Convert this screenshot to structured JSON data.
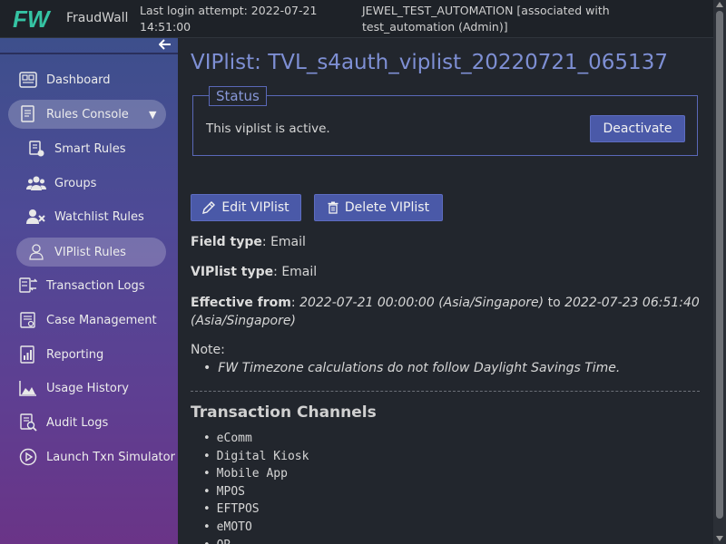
{
  "app": {
    "brand": "FraudWall",
    "logo_text": "FW",
    "login_text": "Last login attempt: 2022-07-21 14:51:00",
    "user_text": "JEWEL_TEST_AUTOMATION [associated with test_automation (Admin)]"
  },
  "sidebar": {
    "collapse_icon": "arrow-left-icon",
    "items": [
      {
        "label": "Dashboard",
        "icon": "dashboard-icon"
      },
      {
        "label": "Rules Console",
        "icon": "rules-console-icon",
        "expanded": true
      },
      {
        "label": "Smart Rules",
        "icon": "smart-rules-icon"
      },
      {
        "label": "Groups",
        "icon": "groups-icon"
      },
      {
        "label": "Watchlist Rules",
        "icon": "watchlist-icon"
      },
      {
        "label": "VIPlist Rules",
        "icon": "viplist-icon",
        "active": true
      },
      {
        "label": "Transaction Logs",
        "icon": "transaction-logs-icon"
      },
      {
        "label": "Case Management",
        "icon": "case-management-icon"
      },
      {
        "label": "Reporting",
        "icon": "reporting-icon"
      },
      {
        "label": "Usage History",
        "icon": "usage-history-icon"
      },
      {
        "label": "Audit Logs",
        "icon": "audit-logs-icon"
      },
      {
        "label": "Launch Txn Simulator",
        "icon": "play-icon"
      }
    ]
  },
  "main": {
    "title": "VIPlist: TVL_s4auth_viplist_20220721_065137",
    "status": {
      "legend": "Status",
      "text": "This viplist is active.",
      "button": "Deactivate"
    },
    "actions": {
      "edit": "Edit VIPlist",
      "delete": "Delete VIPlist"
    },
    "field_type": {
      "label": "Field type",
      "value": "Email"
    },
    "viplist_type": {
      "label": "VIPlist type",
      "value": "Email"
    },
    "effective": {
      "label": "Effective from",
      "from": "2022-07-21 00:00:00 (Asia/Singapore)",
      "to_word": "to",
      "to": "2022-07-23 06:51:40 (Asia/Singapore)"
    },
    "note": {
      "label": "Note:",
      "items": [
        "FW Timezone calculations do not follow Daylight Savings Time."
      ]
    },
    "channels": {
      "title": "Transaction Channels",
      "items": [
        "eComm",
        "Digital Kiosk",
        "Mobile App",
        "MPOS",
        "EFTPOS",
        "eMOTO",
        "QR"
      ]
    }
  },
  "colors": {
    "accent": "#4a59a8",
    "title": "#7e8fd4",
    "background": "#22262d",
    "logo": "#35c3a3"
  }
}
